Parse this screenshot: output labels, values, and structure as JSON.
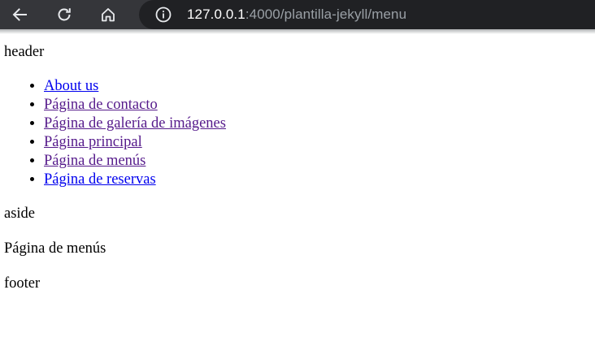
{
  "browser": {
    "url_host": "127.0.0.1",
    "url_rest": ":4000/plantilla-jekyll/menu",
    "icons": [
      "back-arrow-icon",
      "reload-icon",
      "home-icon",
      "info-icon"
    ]
  },
  "page": {
    "header": "header",
    "nav": {
      "items": [
        {
          "label": "About us",
          "visited": false
        },
        {
          "label": "Página de contacto",
          "visited": true
        },
        {
          "label": "Página de galería de imágenes",
          "visited": true
        },
        {
          "label": "Página principal",
          "visited": true
        },
        {
          "label": "Página de menús",
          "visited": true
        },
        {
          "label": "Página de reservas",
          "visited": false
        }
      ]
    },
    "aside": "aside",
    "main": "Página de menús",
    "footer": "footer"
  },
  "colors": {
    "toolbar_bg": "#35363a",
    "omnibox_bg": "#202124",
    "link": "#0000ee",
    "visited_link": "#551a8b"
  }
}
